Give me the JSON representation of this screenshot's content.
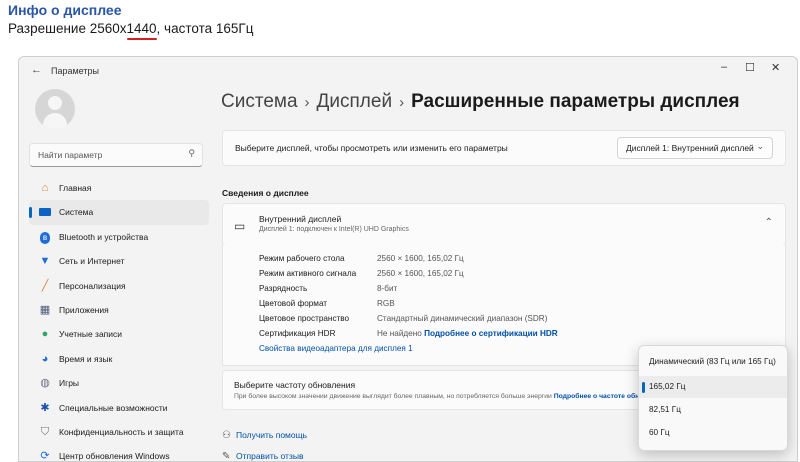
{
  "caption": {
    "title": "Инфо о дисплее",
    "line_before": "Разрешение 2560x",
    "line_highlight": "1440",
    "line_after": ", частота 165Гц",
    "underline_color": "#d21f1f"
  },
  "window": {
    "title": "Параметры",
    "minimize": "–",
    "maximize": "☐",
    "close": "✕"
  },
  "sidebar": {
    "search_placeholder": "Найти параметр",
    "items": [
      {
        "label": "Главная",
        "icon": "home-icon"
      },
      {
        "label": "Система",
        "icon": "system-icon",
        "active": true
      },
      {
        "label": "Bluetooth и устройства",
        "icon": "bluetooth-icon"
      },
      {
        "label": "Сеть и Интернет",
        "icon": "network-icon"
      },
      {
        "label": "Персонализация",
        "icon": "brush-icon"
      },
      {
        "label": "Приложения",
        "icon": "apps-icon"
      },
      {
        "label": "Учетные записи",
        "icon": "account-icon"
      },
      {
        "label": "Время и язык",
        "icon": "globe-icon"
      },
      {
        "label": "Игры",
        "icon": "gamepad-icon"
      },
      {
        "label": "Специальные возможности",
        "icon": "accessibility-icon"
      },
      {
        "label": "Конфиденциальность и защита",
        "icon": "shield-icon"
      },
      {
        "label": "Центр обновления Windows",
        "icon": "update-icon"
      }
    ]
  },
  "breadcrumb": {
    "level1": "Система",
    "level2": "Дисплей",
    "current": "Расширенные параметры дисплея",
    "separator": "›"
  },
  "display_select": {
    "prompt": "Выберите дисплей, чтобы просмотреть или изменить его параметры",
    "value": "Дисплей 1: Внутренний дисплей"
  },
  "info": {
    "section_title": "Сведения о дисплее",
    "display_name": "Внутренний дисплей",
    "display_sub": "Дисплей 1: подключен к Intel(R) UHD Graphics",
    "props": [
      {
        "key": "Режим рабочего стола",
        "value": "2560 × 1600, 165,02 Гц"
      },
      {
        "key": "Режим активного сигнала",
        "value": "2560 × 1600, 165,02 Гц"
      },
      {
        "key": "Разрядность",
        "value": "8-бит"
      },
      {
        "key": "Цветовой формат",
        "value": "RGB"
      },
      {
        "key": "Цветовое пространство",
        "value": "Стандартный динамический диапазон (SDR)"
      }
    ],
    "hdr_key": "Сертификация HDR",
    "hdr_value": "Не найдено",
    "hdr_link": "Подробнее о сертификации HDR",
    "adapter_link": "Свойства видеоадаптера для дисплея 1"
  },
  "refresh": {
    "title": "Выберите частоту обновления",
    "description": "При более высоком значении движение выглядит более плавным, но потребляется больше энергии",
    "link": "Подробнее о частоте обн"
  },
  "refresh_menu": {
    "options": [
      {
        "label": "Динамический (83 Гц или 165 Гц)",
        "selected": false
      },
      {
        "label": "165,02 Гц",
        "selected": true
      },
      {
        "label": "82,51 Гц",
        "selected": false
      },
      {
        "label": "60 Гц",
        "selected": false
      }
    ]
  },
  "footer": {
    "help": "Получить помощь",
    "feedback": "Отправить отзыв"
  },
  "colors": {
    "accent": "#0067c0",
    "link": "#0050a8",
    "caption_title": "#2a55a8"
  }
}
